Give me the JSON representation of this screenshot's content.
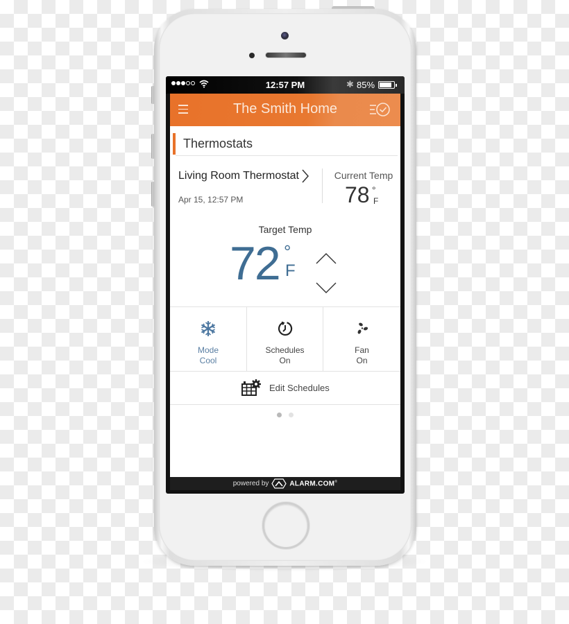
{
  "status_bar": {
    "signal_bars_filled": 3,
    "signal_bars_total": 5,
    "time": "12:57 PM",
    "bluetooth_icon": "bluetooth-icon",
    "battery_percent": "85%",
    "battery_level": 0.85
  },
  "app_bar": {
    "title": "The Smith Home",
    "menu_icon": "hamburger-menu-icon",
    "schedule_icon": "schedule-checklist-icon"
  },
  "section": {
    "title": "Thermostats"
  },
  "thermostat": {
    "name": "Living Room Thermostat",
    "last_updated": "Apr 15, 12:57 PM",
    "current_temp_label": "Current Temp",
    "current_temp": "78",
    "current_temp_degree": "°",
    "current_temp_unit": "F",
    "target_temp_label": "Target Temp",
    "target_temp": "72",
    "target_temp_degree": "°",
    "target_temp_unit": "F"
  },
  "tiles": [
    {
      "icon": "snowflake-icon",
      "label": "Mode",
      "value": "Cool",
      "color": "#5a7fa3"
    },
    {
      "icon": "clock-icon",
      "label": "Schedules",
      "value": "On",
      "color": "#444444"
    },
    {
      "icon": "fan-icon",
      "label": "Fan",
      "value": "On",
      "color": "#444444"
    }
  ],
  "edit_schedules": {
    "label": "Edit Schedules",
    "icon": "calendar-gear-icon"
  },
  "pager": {
    "pages": 2,
    "active_page": 1
  },
  "footer": {
    "powered_by": "powered by",
    "brand": "ALARM.COM",
    "trademark": "®"
  },
  "colors": {
    "accent": "#e8722a",
    "target_temp": "#3f6d93",
    "footer_bg": "#1e1e1e"
  }
}
